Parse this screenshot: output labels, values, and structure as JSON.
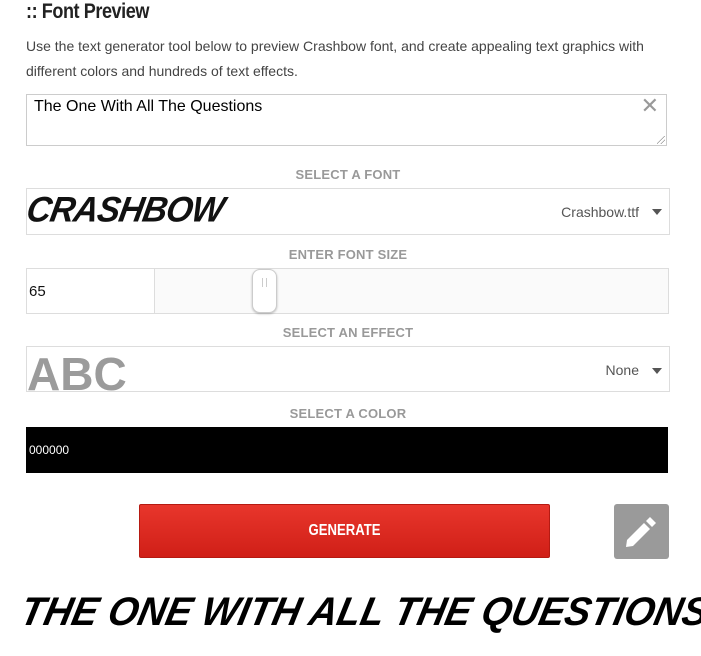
{
  "section": {
    "title": ":: Font Preview",
    "intro": "Use the text generator tool below to preview Crashbow font, and create appealing text graphics with different colors and hundreds of text effects."
  },
  "text_input": {
    "value": "The One With All The Questions",
    "clear_icon": "close-icon"
  },
  "font_select": {
    "label": "SELECT A FONT",
    "sample": "CRASHBOW",
    "value": "Crashbow.ttf"
  },
  "font_size": {
    "label": "ENTER FONT SIZE",
    "value": "65"
  },
  "effect_select": {
    "label": "SELECT AN EFFECT",
    "sample": "ABC",
    "value": "None"
  },
  "color_select": {
    "label": "SELECT A COLOR",
    "value": "000000",
    "color": "#000000"
  },
  "actions": {
    "generate_label": "GENERATE",
    "edit_icon": "pencil-icon"
  },
  "preview": {
    "text": "THE ONE WITH ALL THE QUESTIONS"
  },
  "colors": {
    "accent": "#d9261d",
    "label_gray": "#999999"
  }
}
